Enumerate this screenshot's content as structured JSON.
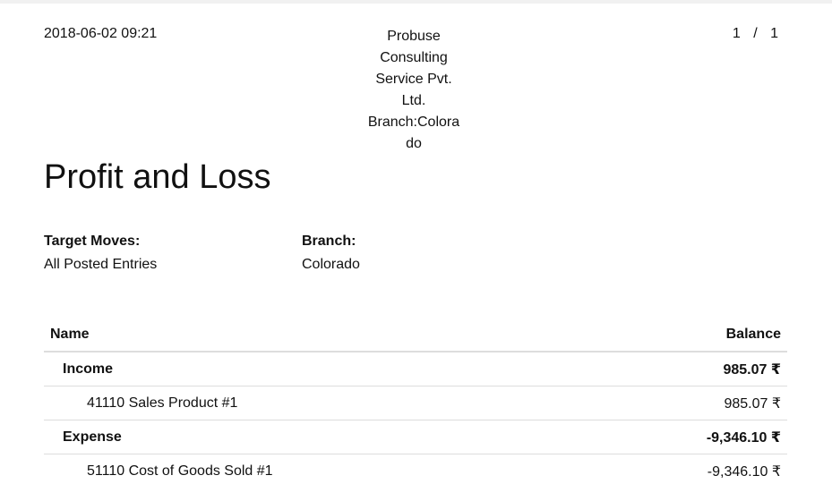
{
  "header": {
    "print_datetime": "2018-06-02 09:21",
    "company_lines": [
      "Probuse",
      "Consulting",
      "Service Pvt.",
      "Ltd.",
      "Branch:Colora",
      "do"
    ],
    "page_current": "1",
    "page_separator": "/",
    "page_total": "1"
  },
  "report": {
    "title": "Profit and Loss"
  },
  "filters": {
    "target_moves_label": "Target Moves:",
    "target_moves_value": "All Posted Entries",
    "branch_label": "Branch:",
    "branch_value": "Colorado"
  },
  "table": {
    "columns": [
      "Name",
      "Balance"
    ],
    "rows": [
      {
        "level": "group",
        "name": "Income",
        "balance": "985.07 ₹"
      },
      {
        "level": "account",
        "name": "41110 Sales Product #1",
        "balance": "985.07 ₹"
      },
      {
        "level": "group",
        "name": "Expense",
        "balance": "-9,346.10 ₹"
      },
      {
        "level": "account",
        "name": "51110 Cost of Goods Sold #1",
        "balance": "-9,346.10 ₹"
      }
    ]
  }
}
